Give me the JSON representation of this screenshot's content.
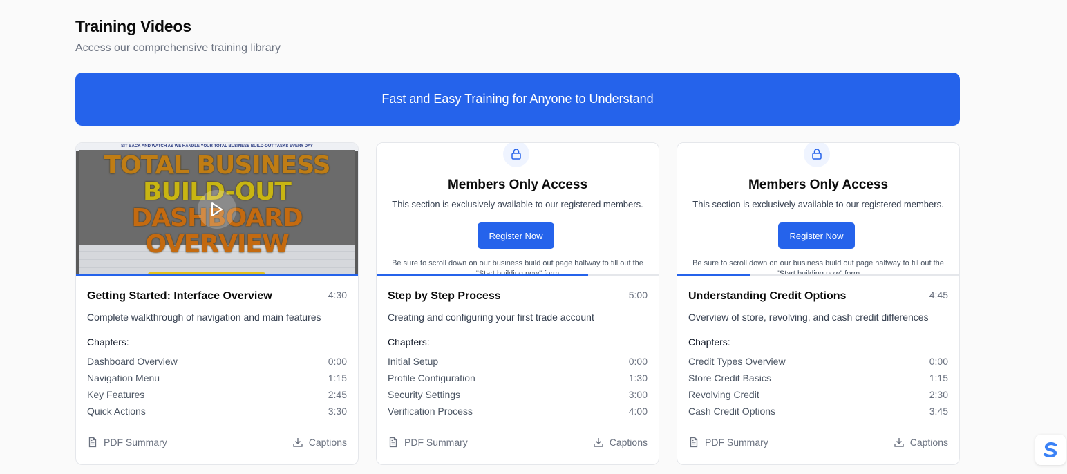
{
  "header": {
    "title": "Training Videos",
    "subtitle": "Access our comprehensive training library"
  },
  "banner": {
    "text": "Fast and Easy Training for Anyone to Understand"
  },
  "cards": [
    {
      "locked": false,
      "progress_percent": 100,
      "thumbnail": {
        "top_text": "SIT BACK AND WATCH AS WE HANDLE YOUR TOTAL BUSINESS BUILD-OUT TASKS EVERY DAY",
        "line1": "TOTAL BUSINESS",
        "line2": "BUILD-OUT",
        "line3": "DASHBOARD OVERVIEW"
      },
      "title": "Getting Started: Interface Overview",
      "duration": "4:30",
      "description": "Complete walkthrough of navigation and main features",
      "chapters_label": "Chapters:",
      "chapters": [
        {
          "name": "Dashboard Overview",
          "time": "0:00"
        },
        {
          "name": "Navigation Menu",
          "time": "1:15"
        },
        {
          "name": "Key Features",
          "time": "2:45"
        },
        {
          "name": "Quick Actions",
          "time": "3:30"
        }
      ],
      "pdf_label": "PDF Summary",
      "captions_label": "Captions"
    },
    {
      "locked": true,
      "progress_percent": 75,
      "members": {
        "heading": "Members Only Access",
        "description": "This section is exclusively available to our registered members.",
        "button": "Register Now",
        "note": "Be sure to scroll down on our business build out page halfway to fill out the \"Start building now\" form"
      },
      "title": "Step by Step Process",
      "duration": "5:00",
      "description": "Creating and configuring your first trade account",
      "chapters_label": "Chapters:",
      "chapters": [
        {
          "name": "Initial Setup",
          "time": "0:00"
        },
        {
          "name": "Profile Configuration",
          "time": "1:30"
        },
        {
          "name": "Security Settings",
          "time": "3:00"
        },
        {
          "name": "Verification Process",
          "time": "4:00"
        }
      ],
      "pdf_label": "PDF Summary",
      "captions_label": "Captions"
    },
    {
      "locked": true,
      "progress_percent": 26,
      "members": {
        "heading": "Members Only Access",
        "description": "This section is exclusively available to our registered members.",
        "button": "Register Now",
        "note": "Be sure to scroll down on our business build out page halfway to fill out the \"Start building now\" form"
      },
      "title": "Understanding Credit Options",
      "duration": "4:45",
      "description": "Overview of store, revolving, and cash credit differences",
      "chapters_label": "Chapters:",
      "chapters": [
        {
          "name": "Credit Types Overview",
          "time": "0:00"
        },
        {
          "name": "Store Credit Basics",
          "time": "1:15"
        },
        {
          "name": "Revolving Credit",
          "time": "2:30"
        },
        {
          "name": "Cash Credit Options",
          "time": "3:45"
        }
      ],
      "pdf_label": "PDF Summary",
      "captions_label": "Captions"
    }
  ],
  "colors": {
    "accent": "#2563eb",
    "badge_blue": "#3b82f6"
  },
  "corner_badge": {
    "icon": "s-logo-icon"
  }
}
